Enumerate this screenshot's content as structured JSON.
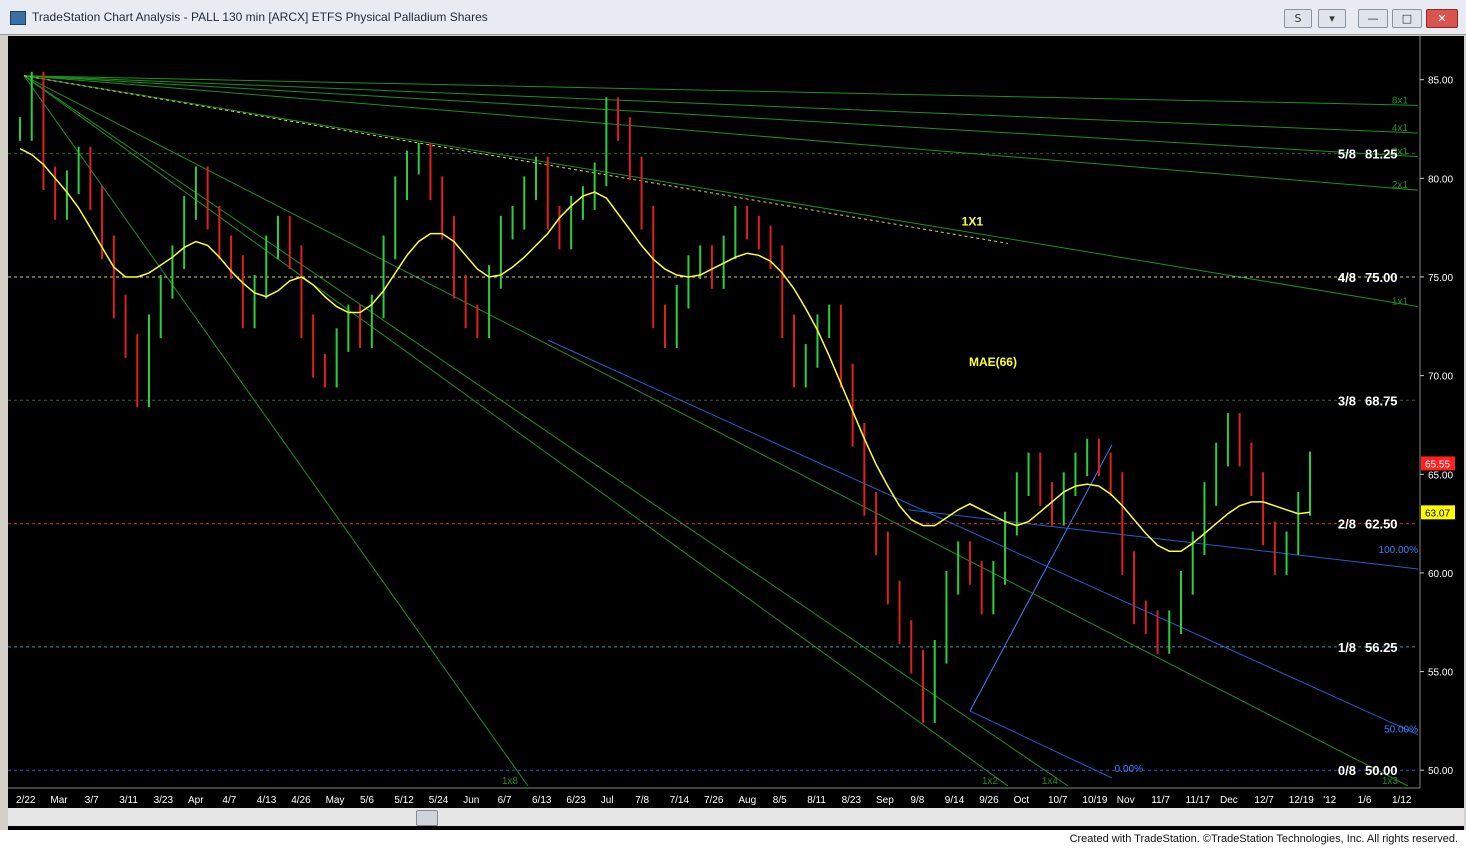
{
  "window": {
    "title": "TradeStation Chart Analysis - PALL 130 min [ARCX] ETFS Physical Palladium Shares",
    "buttons": {
      "s_label": "S",
      "mode_label": "▾",
      "minimize": "—",
      "restore": "□",
      "close": "✕"
    }
  },
  "footer": {
    "credit": "Created with TradeStation. ©TradeStation Technologies, Inc. All rights reserved."
  },
  "colors": {
    "background": "#000000",
    "price_up": "#2ecc40",
    "price_down": "#e02020",
    "mae": "#ffff33",
    "gann_fan": "#1f8f1f",
    "channel": "#1e5fd0",
    "axis_text": "#ffffff",
    "dashed_green": "#2f7f2f"
  },
  "chart_data": {
    "type": "line",
    "symbol": "PALL",
    "interval": "130 min",
    "x_tick_labels": [
      "2/22",
      "Mar",
      "3/7",
      "3/11",
      "3/23",
      "Apr",
      "4/7",
      "4/13",
      "4/26",
      "May",
      "5/6",
      "5/12",
      "5/24",
      "Jun",
      "6/7",
      "6/13",
      "6/23",
      "Jul",
      "7/8",
      "7/14",
      "7/26",
      "Aug",
      "8/5",
      "8/11",
      "8/23",
      "Sep",
      "9/8",
      "9/14",
      "9/26",
      "Oct",
      "10/7",
      "10/19",
      "Nov",
      "11/7",
      "11/17",
      "Dec",
      "12/7",
      "12/19",
      "'12",
      "1/6",
      "1/12"
    ],
    "y_axis": {
      "ylim": [
        49.2,
        86.2
      ],
      "ticks": [
        50,
        55,
        60,
        65,
        70,
        75,
        80,
        85
      ],
      "tick_labels": [
        "50.00",
        "55.00",
        "60.00",
        "65.00",
        "70.00",
        "75.00",
        "80.00",
        "85.00"
      ]
    },
    "murrey_levels": [
      {
        "label": "5/8",
        "value": 81.25,
        "value_text": "81.25",
        "color": "#2f7f2f"
      },
      {
        "label": "4/8",
        "value": 75.0,
        "value_text": "75.00",
        "color": "#ffff66"
      },
      {
        "label": "3/8",
        "value": 68.75,
        "value_text": "68.75",
        "color": "#2f7f2f"
      },
      {
        "label": "2/8",
        "value": 62.5,
        "value_text": "62.50",
        "color": "#ff3030"
      },
      {
        "label": "1/8",
        "value": 56.25,
        "value_text": "56.25",
        "color": "#2fbfbf"
      },
      {
        "label": "0/8",
        "value": 50.0,
        "value_text": "50.00",
        "color": "#2f5fff"
      }
    ],
    "last_price_tags": [
      {
        "value": 65.55,
        "text": "65.55",
        "bg": "#ff2020",
        "fg": "#ffffff"
      },
      {
        "value": 63.07,
        "text": "63.07",
        "bg": "#ffff00",
        "fg": "#000000"
      }
    ],
    "annotations": [
      {
        "text": "1X1",
        "x_index": 0.655,
        "value": 77.6,
        "color": "#ffff33"
      },
      {
        "text": "MAE(66)",
        "x_index": 0.66,
        "value": 70.5,
        "color": "#ffff33"
      }
    ],
    "fan_labels": [
      "8x1",
      "4x1",
      "3x1",
      "2x1",
      "1x1",
      "1x2",
      "1x3",
      "1x4",
      "1x8"
    ],
    "fib_labels": [
      "100.00%",
      "50.00%",
      "0.00%"
    ],
    "close_series_note": "approximate closes (130-min bars) read from price axis",
    "price": [
      82.5,
      84.8,
      80.0,
      78.5,
      79.8,
      81.0,
      79.0,
      76.5,
      73.5,
      71.5,
      69.0,
      72.5,
      74.5,
      76.0,
      78.5,
      80.0,
      78.0,
      76.5,
      75.5,
      73.0,
      74.5,
      76.5,
      77.5,
      76.0,
      72.5,
      70.5,
      70.0,
      71.8,
      73.0,
      72.0,
      73.5,
      76.5,
      79.5,
      80.8,
      81.2,
      79.5,
      77.5,
      74.5,
      73.0,
      72.5,
      75.0,
      77.5,
      78.0,
      79.5,
      80.5,
      78.0,
      77.0,
      78.5,
      79.0,
      80.2,
      83.5,
      82.5,
      80.5,
      78.0,
      73.0,
      72.0,
      74.0,
      75.5,
      76.0,
      75.0,
      76.5,
      78.0,
      77.5,
      77.0,
      76.0,
      72.5,
      70.0,
      71.0,
      72.5,
      73.0,
      70.0,
      67.0,
      63.5,
      61.5,
      59.0,
      57.0,
      55.5,
      53.0,
      56.0,
      59.5,
      61.0,
      60.0,
      58.5,
      60.0,
      62.5,
      64.5,
      65.5,
      64.0,
      63.0,
      64.5,
      65.5,
      66.2,
      65.5,
      64.5,
      60.5,
      58.0,
      57.5,
      56.5,
      57.5,
      59.5,
      61.5,
      64.0,
      66.0,
      67.5,
      66.0,
      64.5,
      62.0,
      60.5,
      61.5,
      63.5,
      65.55
    ],
    "mae_66": [
      81.5,
      81.2,
      80.7,
      80.0,
      79.3,
      78.5,
      77.5,
      76.5,
      75.5,
      75.0,
      75.0,
      75.2,
      75.6,
      76.0,
      76.5,
      76.8,
      76.6,
      76.0,
      75.3,
      74.7,
      74.2,
      74.0,
      74.3,
      74.8,
      75.0,
      74.6,
      74.0,
      73.5,
      73.2,
      73.2,
      73.6,
      74.3,
      75.2,
      76.1,
      76.8,
      77.2,
      77.2,
      76.8,
      76.1,
      75.4,
      75.0,
      75.1,
      75.5,
      76.0,
      76.6,
      77.2,
      78.0,
      78.6,
      79.1,
      79.3,
      79.0,
      78.2,
      77.4,
      76.6,
      75.9,
      75.4,
      75.1,
      75.0,
      75.1,
      75.4,
      75.7,
      76.0,
      76.2,
      76.1,
      75.8,
      75.2,
      74.4,
      73.4,
      72.3,
      71.0,
      69.6,
      68.2,
      66.8,
      65.5,
      64.4,
      63.4,
      62.7,
      62.4,
      62.4,
      62.8,
      63.2,
      63.5,
      63.2,
      62.9,
      62.6,
      62.4,
      62.6,
      63.1,
      63.6,
      64.1,
      64.4,
      64.5,
      64.4,
      64.0,
      63.4,
      62.7,
      62.0,
      61.4,
      61.1,
      61.1,
      61.5,
      62.0,
      62.5,
      63.0,
      63.4,
      63.6,
      63.6,
      63.4,
      63.2,
      63.0,
      63.07
    ]
  }
}
